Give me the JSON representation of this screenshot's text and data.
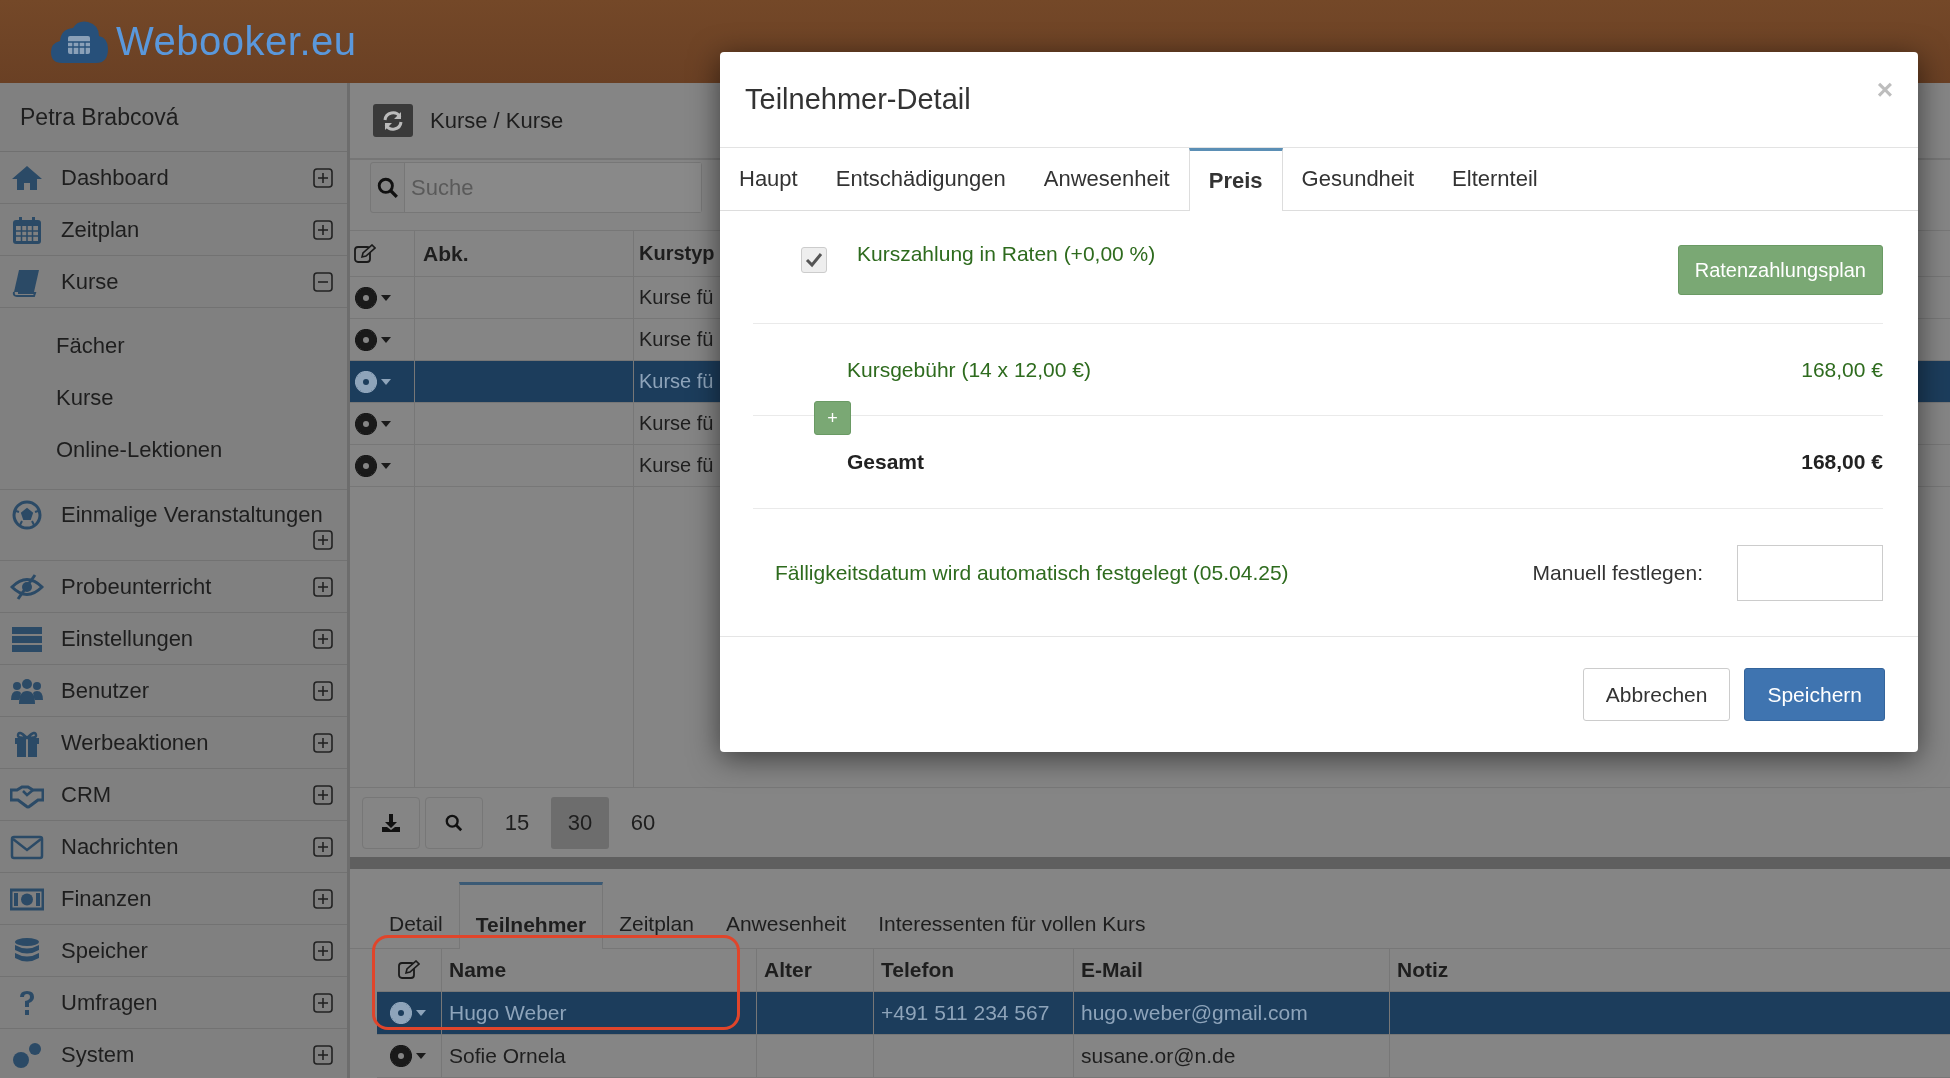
{
  "header": {
    "logo": "Webooker.eu"
  },
  "sidebar": {
    "user": "Petra Brabcová",
    "items": [
      {
        "label": "Dashboard",
        "expanded": false
      },
      {
        "label": "Zeitplan",
        "expanded": false
      },
      {
        "label": "Kurse",
        "expanded": true,
        "children": [
          {
            "label": "Fächer"
          },
          {
            "label": "Kurse"
          },
          {
            "label": "Online-Lektionen"
          }
        ]
      },
      {
        "label": "Einmalige Veranstaltungen",
        "expanded": false
      },
      {
        "label": "Probeunterricht",
        "expanded": false
      },
      {
        "label": "Einstellungen",
        "expanded": false
      },
      {
        "label": "Benutzer",
        "expanded": false
      },
      {
        "label": "Werbeaktionen",
        "expanded": false
      },
      {
        "label": "CRM",
        "expanded": false
      },
      {
        "label": "Nachrichten",
        "expanded": false
      },
      {
        "label": "Finanzen",
        "expanded": false
      },
      {
        "label": "Speicher",
        "expanded": false
      },
      {
        "label": "Umfragen",
        "expanded": false
      },
      {
        "label": "System",
        "expanded": false
      }
    ]
  },
  "main": {
    "breadcrumb": "Kurse / Kurse",
    "search": {
      "placeholder": "Suche"
    },
    "table": {
      "columns": [
        "Abk.",
        "Kurstyp"
      ],
      "rows": [
        {
          "abk": "",
          "kurstyp": "Kurse fü",
          "selected": false
        },
        {
          "abk": "",
          "kurstyp": "Kurse fü",
          "selected": false
        },
        {
          "abk": "",
          "kurstyp": "Kurse fü",
          "selected": true
        },
        {
          "abk": "",
          "kurstyp": "Kurse fü",
          "selected": false
        },
        {
          "abk": "",
          "kurstyp": "Kurse fü",
          "selected": false
        }
      ]
    },
    "page_sizes": [
      {
        "label": "15",
        "selected": false
      },
      {
        "label": "30",
        "selected": true
      },
      {
        "label": "60",
        "selected": false
      }
    ]
  },
  "detail": {
    "tabs": [
      {
        "label": "Detail",
        "selected": false
      },
      {
        "label": "Teilnehmer",
        "selected": true
      },
      {
        "label": "Zeitplan",
        "selected": false
      },
      {
        "label": "Anwesenheit",
        "selected": false
      },
      {
        "label": "Interessenten für vollen Kurs",
        "selected": false
      }
    ],
    "table": {
      "columns": [
        "Name",
        "Alter",
        "Telefon",
        "E-Mail",
        "Notiz"
      ],
      "rows": [
        {
          "cells": [
            "Hugo Weber",
            "",
            "+491 511 234 567",
            "hugo.weber@gmail.com",
            ""
          ],
          "selected": true
        },
        {
          "cells": [
            "Sofie Ornela",
            "",
            "",
            "susane.or@n.de",
            ""
          ],
          "selected": false
        }
      ]
    }
  },
  "dialog": {
    "title": "Teilnehmer-Detail",
    "close": "×",
    "tabs": [
      {
        "label": "Haupt",
        "selected": false
      },
      {
        "label": "Entschädigungen",
        "selected": false
      },
      {
        "label": "Anwesenheit",
        "selected": false
      },
      {
        "label": "Preis",
        "selected": true
      },
      {
        "label": "Gesundheit",
        "selected": false
      },
      {
        "label": "Elternteil",
        "selected": false
      }
    ],
    "installments": {
      "checked": true,
      "label": "Kurszahlung in Raten (+0,00 %)",
      "button": "Ratenzahlungsplan"
    },
    "fee": {
      "label": "Kursgebühr (14 x 12,00 €)",
      "amount": "168,00 €"
    },
    "add_button": "+",
    "total": {
      "label": "Gesamt",
      "amount": "168,00 €"
    },
    "due": {
      "text": "Fälligkeitsdatum wird automatisch festgelegt (05.04.25)",
      "manual_label": "Manuell festlegen:"
    },
    "buttons": [
      {
        "label": "Abbrechen",
        "kind": "secondary"
      },
      {
        "label": "Speichern",
        "kind": "primary"
      }
    ]
  }
}
